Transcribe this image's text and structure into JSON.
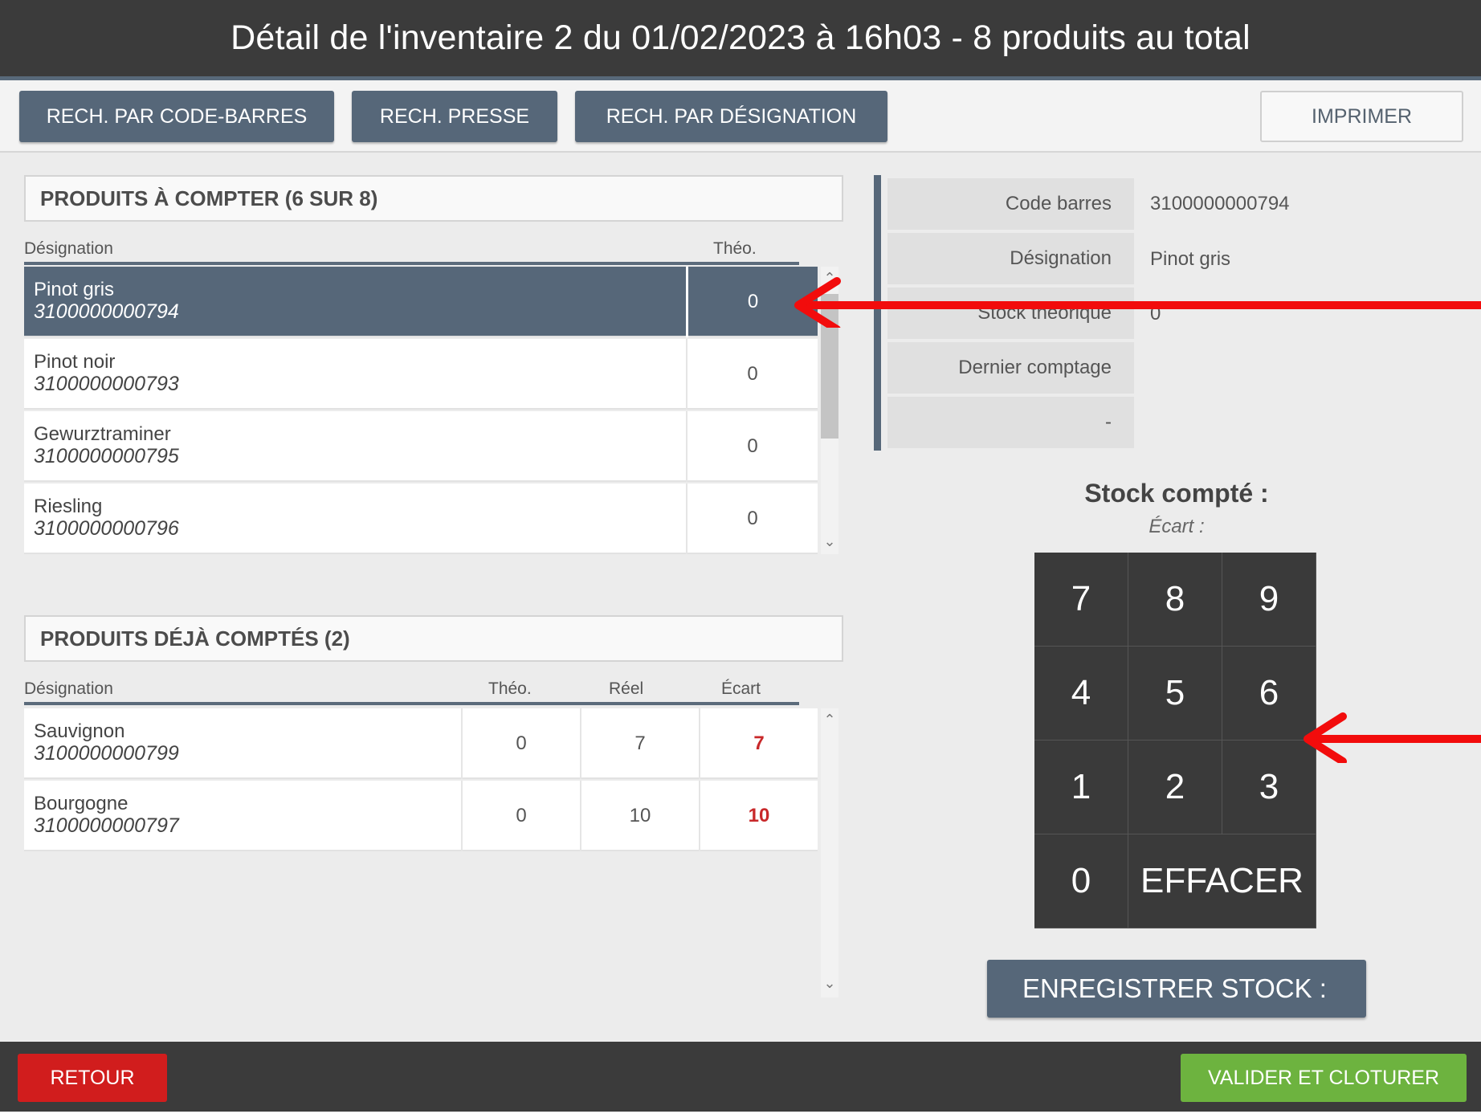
{
  "header": {
    "title": "Détail de l'inventaire 2 du 01/02/2023 à 16h03 - 8 produits au total"
  },
  "toolbar": {
    "barcode_search": "RECH. PAR CODE-BARRES",
    "press_search": "RECH. PRESSE",
    "designation_search": "RECH. PAR DÉSIGNATION",
    "print": "IMPRIMER"
  },
  "to_count": {
    "title": "PRODUITS À COMPTER (6 SUR 8)",
    "col_designation": "Désignation",
    "col_theo": "Théo.",
    "rows": [
      {
        "name": "Pinot gris",
        "code": "3100000000794",
        "theo": "0",
        "selected": true
      },
      {
        "name": "Pinot noir",
        "code": "3100000000793",
        "theo": "0"
      },
      {
        "name": "Gewurztraminer",
        "code": "3100000000795",
        "theo": "0"
      },
      {
        "name": "Riesling",
        "code": "3100000000796",
        "theo": "0"
      }
    ]
  },
  "counted": {
    "title": "PRODUITS DÉJÀ COMPTÉS (2)",
    "col_designation": "Désignation",
    "col_theo": "Théo.",
    "col_reel": "Réel",
    "col_ecart": "Écart",
    "rows": [
      {
        "name": "Sauvignon",
        "code": "3100000000799",
        "theo": "0",
        "reel": "7",
        "ecart": "7"
      },
      {
        "name": "Bourgogne",
        "code": "3100000000797",
        "theo": "0",
        "reel": "10",
        "ecart": "10"
      }
    ]
  },
  "detail": {
    "barcode_label": "Code barres",
    "barcode_value": "3100000000794",
    "designation_label": "Désignation",
    "designation_value": "Pinot gris",
    "stock_theo_label": "Stock théorique",
    "stock_theo_value": "0",
    "last_count_label": "Dernier comptage",
    "extra_label": "-"
  },
  "counting": {
    "stock_title": "Stock compté :",
    "ecart_title": "Écart :",
    "keys": [
      "7",
      "8",
      "9",
      "4",
      "5",
      "6",
      "1",
      "2",
      "3",
      "0"
    ],
    "clear": "EFFACER",
    "save": "ENREGISTRER STOCK :"
  },
  "footer": {
    "back": "RETOUR",
    "validate": "VALIDER ET CLOTURER"
  },
  "colors": {
    "accent": "#566779",
    "danger": "#d11d1d",
    "success": "#6db33f",
    "annotation": "#f20c0c"
  }
}
